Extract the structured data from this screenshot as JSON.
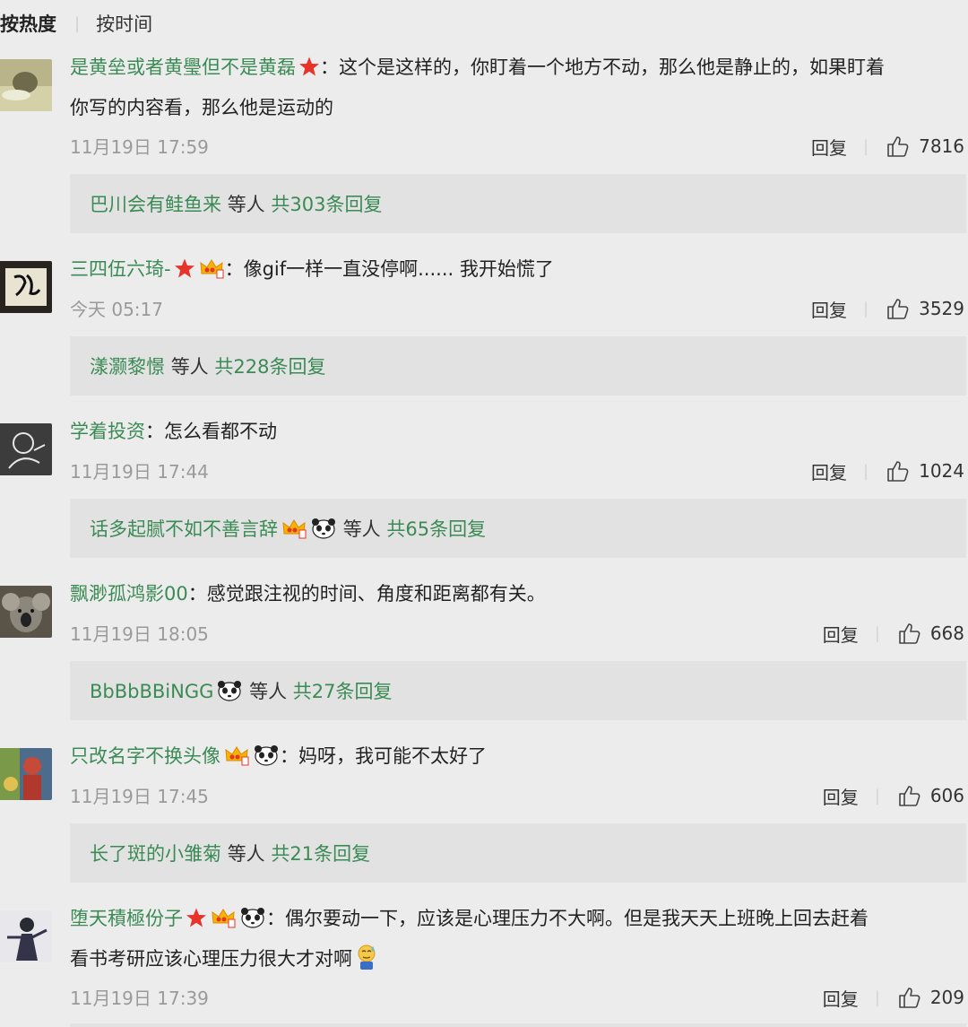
{
  "sort": {
    "hot_label": "按热度",
    "time_label": "按时间"
  },
  "ui": {
    "reply_label": "回复",
    "others_label": "等人"
  },
  "comments": [
    {
      "user": "是黄垒或者黄璺但不是黄磊",
      "badges": [
        "star-icon"
      ],
      "text_line1": "：这个是这样的，你盯着一个地方不动，那么他是静止的，如果盯着",
      "text_line2": "你写的内容看，那么他是运动的",
      "time": "11月19日 17:59",
      "likes": "7816",
      "reply_users": "巴川会有鲑鱼来",
      "reply_users_badges": [],
      "reply_total": "共303条回复"
    },
    {
      "user": "三四伍六琦-",
      "badges": [
        "star-icon",
        "vip-crown-icon"
      ],
      "text_line1": "：像gif一样一直没停啊...... 我开始慌了",
      "time": "今天 05:17",
      "likes": "3529",
      "reply_users": "漾灏黎憬",
      "reply_users_badges": [],
      "reply_total": "共228条回复"
    },
    {
      "user": "学着投资",
      "badges": [],
      "text_line1": "：怎么看都不动",
      "time": "11月19日 17:44",
      "likes": "1024",
      "reply_users": "话多起腻不如不善言辞",
      "reply_users_badges": [
        "vip-crown-icon",
        "panda-icon"
      ],
      "reply_total": "共65条回复"
    },
    {
      "user": "飘渺孤鸿影00",
      "badges": [],
      "text_line1": "：感觉跟注视的时间、角度和距离都有关。",
      "time": "11月19日 18:05",
      "likes": "668",
      "reply_users": "BbBbBBiNGG",
      "reply_users_badges": [
        "panda-icon"
      ],
      "reply_total": "共27条回复"
    },
    {
      "user": "只改名字不换头像",
      "badges": [
        "vip-crown-icon",
        "panda-icon"
      ],
      "text_line1": "：妈呀，我可能不太好了",
      "time": "11月19日 17:45",
      "likes": "606",
      "reply_users": "长了斑的小雏菊",
      "reply_users_badges": [],
      "reply_total": "共21条回复"
    },
    {
      "user": "堕天積極份子",
      "badges": [
        "star-icon",
        "vip-crown-icon",
        "panda-icon"
      ],
      "text_line1": "：偶尔要动一下，应该是心理压力不大啊。但是我天天上班晚上回去赶着",
      "text_line2": "看书考研应该心理压力很大才对啊",
      "emoji": "sweat-emoji-icon",
      "time": "11月19日 17:39",
      "likes": "209"
    }
  ],
  "colors": {
    "username": "#3b8b55",
    "background": "#ececec",
    "reply_box": "#e2e2e2",
    "meta_text": "#9a9a9a"
  }
}
